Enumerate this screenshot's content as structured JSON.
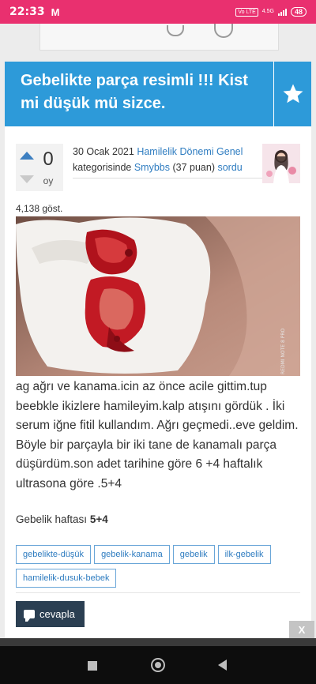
{
  "status_bar": {
    "time": "22:33",
    "mail_icon": "M",
    "network_label": "Vo LTE",
    "network_gen": "4.5G",
    "battery": "48"
  },
  "question": {
    "title": "Gebelikte parça resimli !!! Kist mi düşük mü sizce.",
    "votes": {
      "count": "0",
      "label": "oy"
    },
    "meta": {
      "date": "30 Ocak 2021",
      "category": "Hamilelik Dönemi Genel",
      "category_suffix": "kategorisinde",
      "user": "Smybbs",
      "points": "(37 puan)",
      "action": "sordu"
    },
    "views": "4,138 göst.",
    "body": "ag ağrı ve kanama.icin az önce acile gittim.tup beebkle ikizlere hamileyim.kalp atışını gördük . İki serum iğne fitil kullandım. Ağrı geçmedi..eve geldim. Böyle bir parçayla bir iki tane de kanamalı parça düşürdüm.son adet tarihine göre 6 +4 haftalık ultrasona göre .5+4",
    "pregnancy_week_label": "Gebelik haftası",
    "pregnancy_week_value": "5+4",
    "tags": [
      "gebelikte-düşük",
      "gebelik-kanama",
      "gebelik",
      "ilk-gebelik",
      "hamilelik-dusuk-bebek"
    ],
    "reply_label": "cevapla",
    "photo_watermark": "REDMI NOTE 8 PRO"
  },
  "ad_close": "X",
  "colors": {
    "status_bar": "#e9306f",
    "title_banner": "#2d9ad9",
    "link": "#2e7cc0",
    "reply_button": "#2b3f52"
  },
  "icons": [
    "mail-icon",
    "signal-icon",
    "battery-icon",
    "star-icon",
    "vote-up-icon",
    "vote-down-icon",
    "comment-icon",
    "nav-recent-icon",
    "nav-home-icon",
    "nav-back-icon"
  ]
}
